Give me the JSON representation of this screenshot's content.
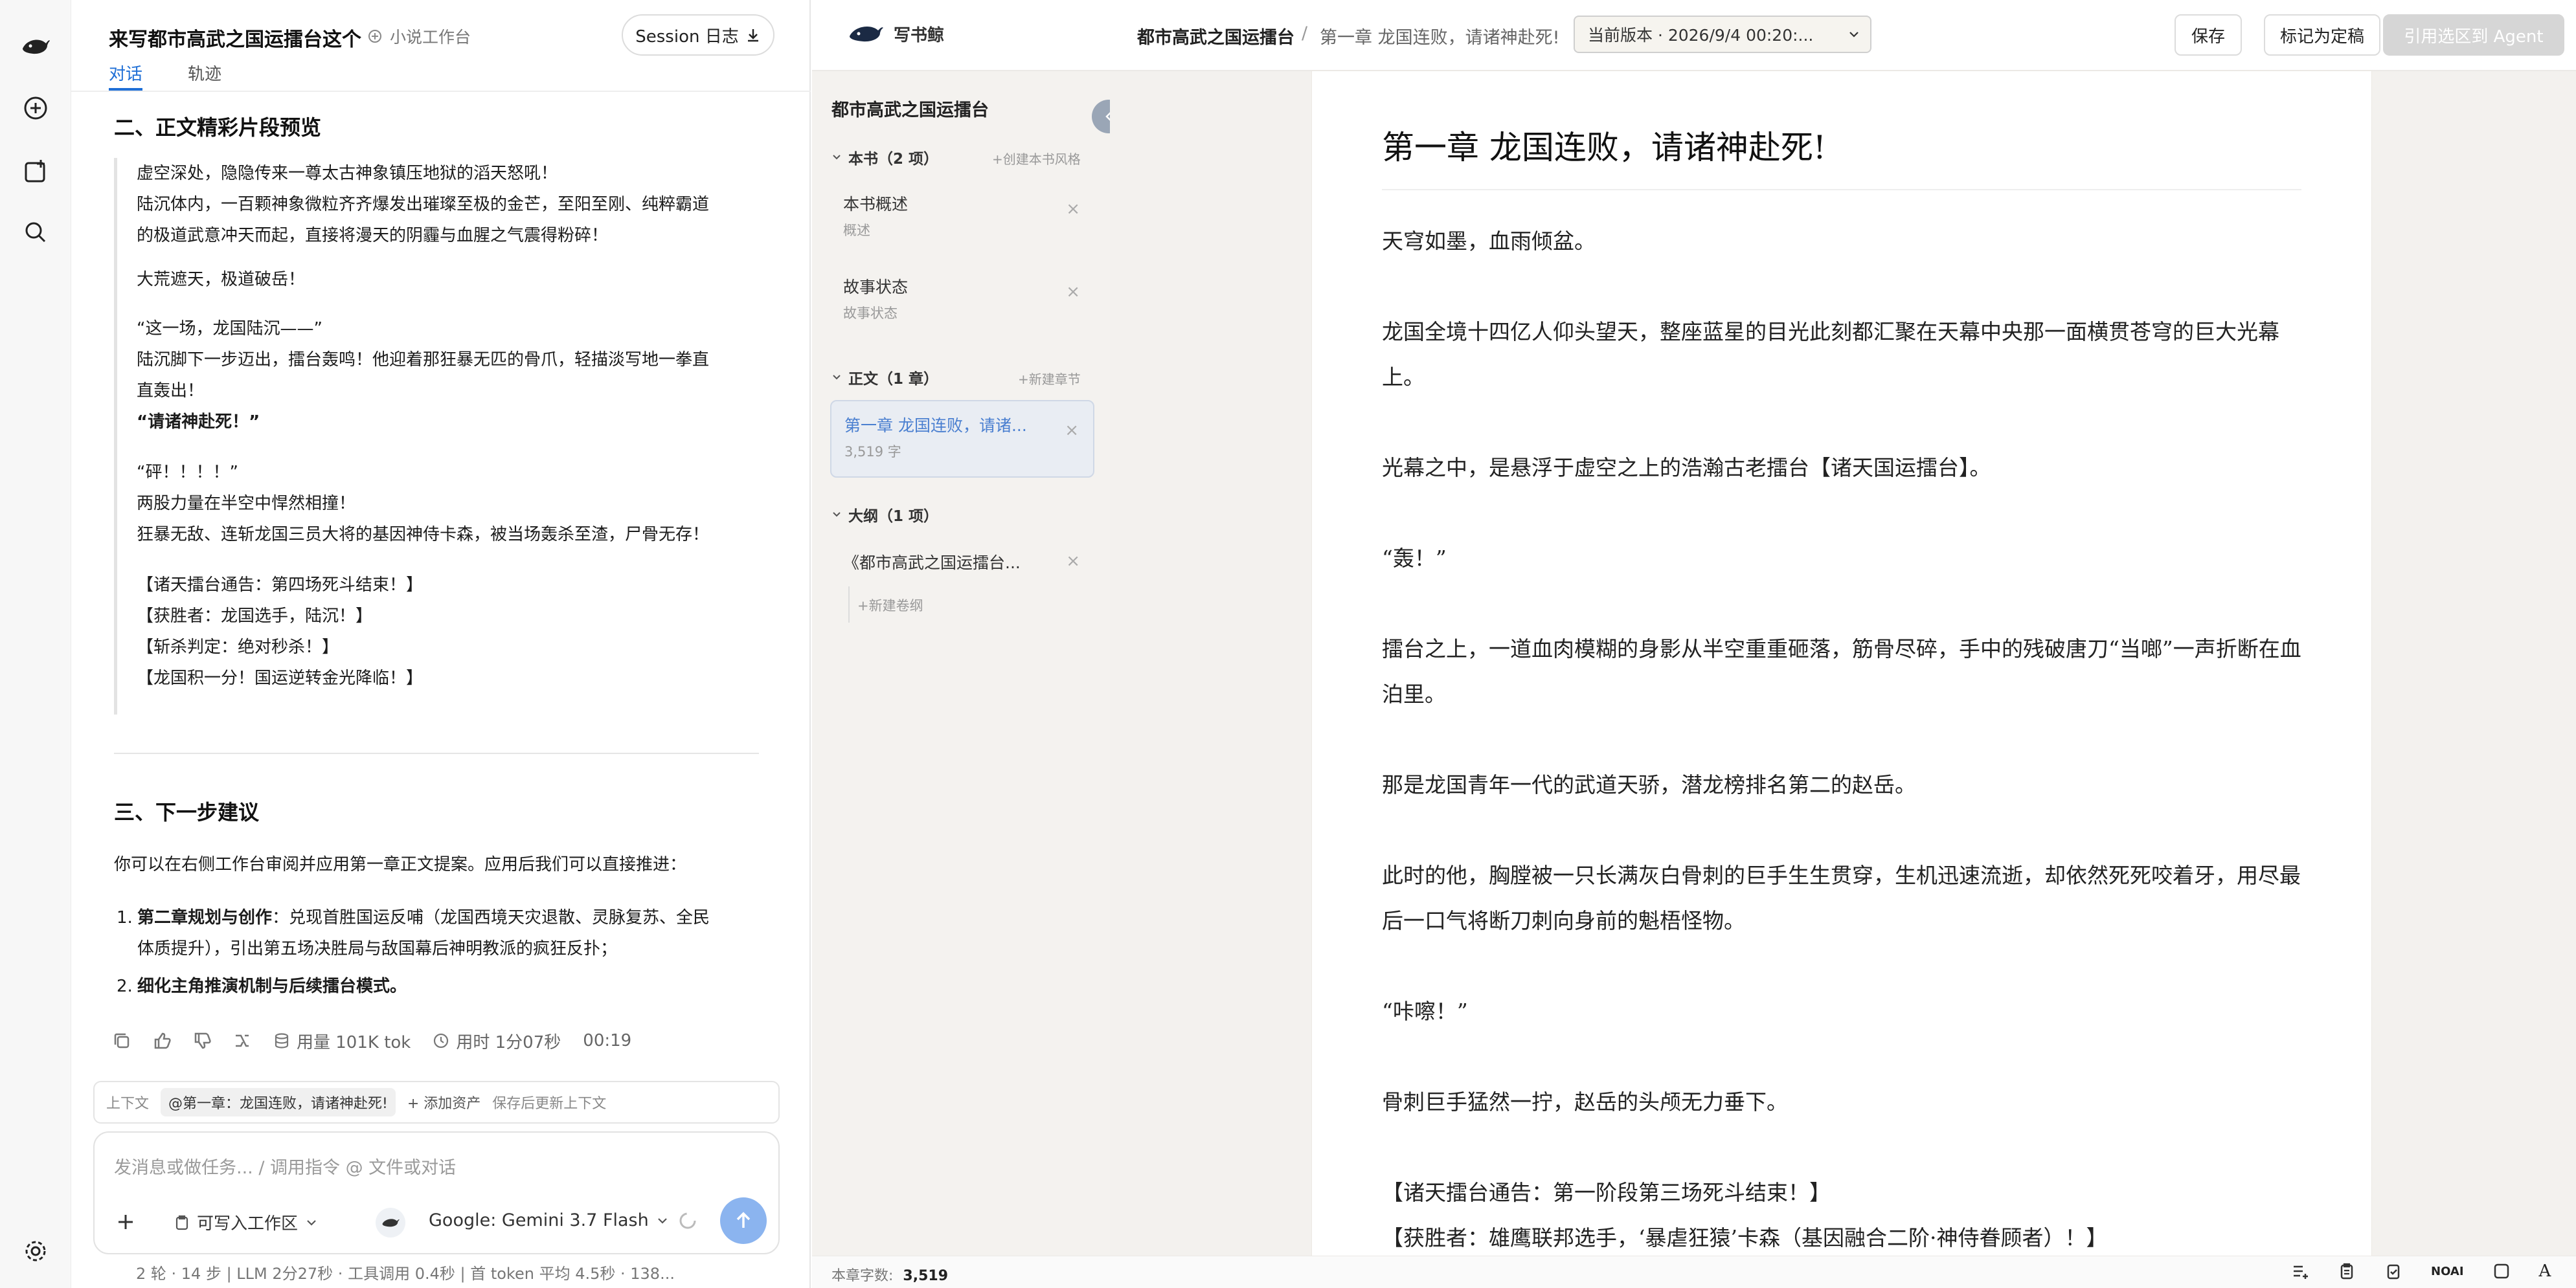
{
  "chat": {
    "title": "来写都市高武之国运擂台这个",
    "workspace_tag": "小说工作台",
    "session_btn": "Session 日志",
    "tabs": [
      "对话",
      "轨迹"
    ],
    "section2_title": "二、正文精彩片段预览",
    "quote_lines": [
      "虚空深处，隐隐传来一尊太古神象镇压地狱的滔天怒吼！",
      "陆沉体内，一百颗神象微粒齐齐爆发出璀璨至极的金芒，至阳至刚、纯粹霸道",
      "的极道武意冲天而起，直接将漫天的阴霾与血腥之气震得粉碎！",
      "大荒遮天，极道破岳！",
      "“这一场，龙国陆沉——”",
      "陆沉脚下一步迈出，擂台轰鸣！他迎着那狂暴无匹的骨爪，轻描淡写地一拳直",
      "直轰出！",
      "“请诸神赴死！”",
      "“砰！！！！”",
      "两股力量在半空中悍然相撞！",
      "狂暴无敌、连斩龙国三员大将的基因神侍卡森，被当场轰杀至渣，尸骨无存！",
      "【诸天擂台通告：第四场死斗结束！】",
      "【获胜者：龙国选手，陆沉！】",
      "【斩杀判定：绝对秒杀！】",
      "【龙国积一分！国运逆转金光降临！】"
    ],
    "section3_title": "三、下一步建议",
    "next_intro": "你可以在右侧工作台审阅并应用第一章正文提案。应用后我们可以直接推进：",
    "list1_num": "1.",
    "list1_bold": "第二章规划与创作",
    "list1_rest": "：兑现首胜国运反哺（龙国西境天灾退散、灵脉复苏、全民",
    "list1_line2": "体质提升），引出第五场决胜局与敌国幕后神明教派的疯狂反扑；",
    "list2_num": "2.",
    "list2_bold": "细化主角推演机制与后续擂台模式。",
    "usage": "用量 101K tok",
    "elapsed": "用时 1分07秒",
    "clock": "00:19",
    "ctx_label": "上下文",
    "ctx_chip": "@第一章：龙国连败，请诸神赴死!",
    "ctx_add": "+ 添加资产",
    "ctx_hint": "保存后更新上下文",
    "composer_placeholder": "发消息或做任务... / 调用指令 @ 文件或对话",
    "writable": "可写入工作区",
    "model": "Google: Gemini 3.7 Flash",
    "status": "2 轮 · 14 步  |  LLM 2分27秒 · 工具调用 0.4秒  |  首 token 平均 4.5秒 · 138..."
  },
  "editor": {
    "logo_text": "写书鲸",
    "crumb_book": "都市高武之国运擂台",
    "crumb_sep": "/",
    "crumb_chapter": "第一章 龙国连败，请诸神赴死!",
    "version": "当前版本 · 2026/9/4 00:20:...",
    "save": "保存",
    "mark_final": "标记为定稿",
    "quote_agent": "引用选区到 Agent",
    "word_count_label": "本章字数:",
    "word_count": "3,519",
    "bottom_noai": "NOAI",
    "bottom_font": "A"
  },
  "outline": {
    "book_title": "都市高武之国运擂台",
    "sec_book": "本书（2 项）",
    "sec_book_link": "+创建本书风格",
    "item_overview_t": "本书概述",
    "item_overview_s": "概述",
    "item_story_t": "故事状态",
    "item_story_s": "故事状态",
    "sec_text": "正文（1 章）",
    "sec_text_link": "+新建章节",
    "ch1_t": "第一章 龙国连败，请诸...",
    "ch1_s": "3,519 字",
    "sec_outline": "大纲（1 项）",
    "outline_item": "《都市高武之国运擂台...",
    "new_volume": "+新建卷纲"
  },
  "chapter": {
    "title": "第一章 龙国连败，请诸神赴死!",
    "paragraphs": [
      "天穹如墨，血雨倾盆。",
      "龙国全境十四亿人仰头望天，整座蓝星的目光此刻都汇聚在天幕中央那一面横贯苍穹的巨大光幕上。",
      "光幕之中，是悬浮于虚空之上的浩瀚古老擂台【诸天国运擂台】。",
      "“轰！”",
      "擂台之上，一道血肉模糊的身影从半空重重砸落，筋骨尽碎，手中的残破唐刀“当啷”一声折断在血泊里。",
      "那是龙国青年一代的武道天骄，潜龙榜排名第二的赵岳。",
      "此时的他，胸膛被一只长满灰白骨刺的巨手生生贯穿，生机迅速流逝，却依然死死咬着牙，用尽最后一口气将断刀刺向身前的魁梧怪物。",
      "“咔嚓！”",
      "骨刺巨手猛然一拧，赵岳的头颅无力垂下。",
      "【诸天擂台通告：第一阶段第三场死斗结束！】",
      "【获胜者：雄鹰联邦选手，‘暴虐狂猿’卡森（基因融合二阶·神侍眷顾者）！】"
    ]
  },
  "colors": {
    "accent": "#1f6fd6",
    "send": "#8bb4ef",
    "agent_disabled": "#d6d6d6"
  }
}
